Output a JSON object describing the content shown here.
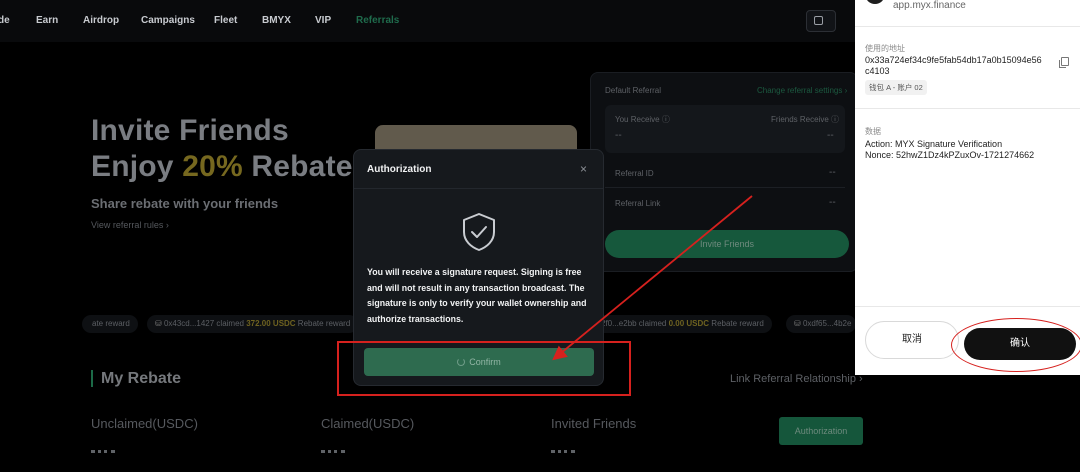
{
  "nav": {
    "items": [
      {
        "label": "de"
      },
      {
        "label": "Earn"
      },
      {
        "label": "Airdrop"
      },
      {
        "label": "Campaigns"
      },
      {
        "label": "Fleet"
      },
      {
        "label": "BMYX"
      },
      {
        "label": "VIP"
      },
      {
        "label": "Referrals",
        "active": true
      }
    ]
  },
  "hero": {
    "line1": "Invite Friends",
    "line2_prefix": "Enjoy ",
    "line2_highlight": "20%",
    "line2_suffix": " Rebate",
    "subtitle": "Share rebate with your friends",
    "rules_link": "View referral rules ›"
  },
  "referral_panel": {
    "default_referral": "Default Referral",
    "change_settings": "Change referral settings ›",
    "you_receive": "You Receive ⓘ",
    "you_receive_value": "--",
    "friends_receive": "Friends Receive ⓘ",
    "friends_receive_value": "--",
    "referral_id": "Referral ID",
    "referral_id_value": "--",
    "referral_link": "Referral Link",
    "referral_link_value": "--",
    "invite_button": "Invite Friends"
  },
  "ticker": {
    "items": [
      {
        "pre": "ate reward",
        "amt": "",
        "post": ""
      },
      {
        "pre": "0x43cd...1427 claimed ",
        "amt": "372.00 USDC",
        "post": " Rebate reward"
      },
      {
        "pre": "2f0...e2bb claimed ",
        "amt": "0.00 USDC",
        "post": " Rebate reward"
      },
      {
        "pre": "0xdf65...4b2e",
        "amt": "",
        "post": ""
      }
    ]
  },
  "my_rebate": {
    "title": "My Rebate",
    "link_relationship": "Link Referral Relationship ›",
    "unclaimed": "Unclaimed(USDC)",
    "claimed": "Claimed(USDC)",
    "invited": "Invited Friends",
    "authorization_button": "Authorization"
  },
  "modal": {
    "title": "Authorization",
    "close": "×",
    "message": "You will receive a signature request. Signing is free and will not result in any transaction broadcast. The signature is only to verify your wallet ownership and authorize transactions.",
    "confirm_label": "Confirm"
  },
  "wallet": {
    "site": "app.myx.finance",
    "address_label": "使用的地址",
    "address": "0x33a724ef34c9fe5fab54db17a0b15094e56c4103",
    "account": "钱包 A - 账户 02",
    "data_label": "数据",
    "data_line1": "Action: MYX Signature Verification",
    "data_line2": "Nonce: 52hwZ1Dz4kPZuxOv-1721274662",
    "cancel": "取消",
    "confirm": "确认"
  },
  "colors": {
    "accent_green": "#1f6b4c",
    "highlight_gold": "#c9a800",
    "annotation_red": "#d6211e"
  }
}
